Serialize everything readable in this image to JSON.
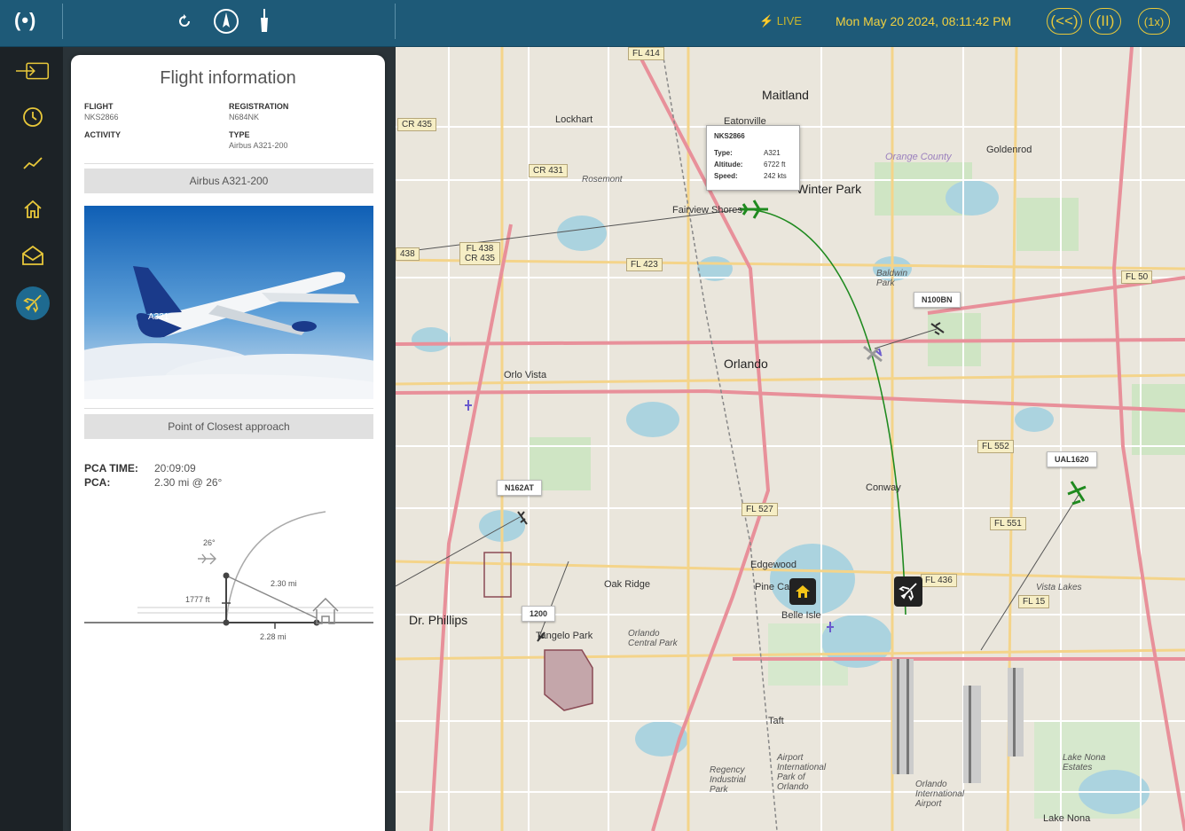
{
  "topbar": {
    "logo": "(•)",
    "live": "⚡ LIVE",
    "datetime": "Mon May 20 2024, 08:11:42 PM",
    "controls": [
      "(<<)",
      "(II)",
      "(1x)"
    ]
  },
  "sidebar": {
    "items": [
      "login-icon",
      "clock-icon",
      "chart-icon",
      "home-icon",
      "mail-icon",
      "plane-icon"
    ]
  },
  "panel": {
    "title": "Flight information",
    "flight_label": "FLIGHT",
    "flight_value": "NKS2866",
    "registration_label": "REGISTRATION",
    "registration_value": "N684NK",
    "activity_label": "ACTIVITY",
    "type_label": "TYPE",
    "type_value": "Airbus A321-200",
    "aircraft_banner": "Airbus A321-200",
    "pca_banner": "Point of Closest approach",
    "pca_time_label": "PCA TIME:",
    "pca_time_value": "20:09:09",
    "pca_label": "PCA:",
    "pca_value": "2.30 mi @ 26°",
    "diagram": {
      "angle": "26°",
      "slant": "2.30 mi",
      "altitude": "1777 ft",
      "ground": "2.28 mi"
    }
  },
  "map": {
    "tooltip": {
      "callsign": "NKS2866",
      "type_label": "Type:",
      "type_value": "A321",
      "altitude_label": "Altitude:",
      "altitude_value": "6722 ft",
      "speed_label": "Speed:",
      "speed_value": "242 kts"
    },
    "aircraft_tags": [
      "N100BN",
      "N162AT",
      "1200",
      "UAL1620"
    ],
    "places": [
      "Maitland",
      "Lockhart",
      "Winter Park",
      "Fairview Shores",
      "Orlando",
      "Orlo Vista",
      "Conway",
      "Edgewood",
      "Pine Castle",
      "Belle Isle",
      "Oak Ridge",
      "Dr. Phillips",
      "Tangelo Park",
      "Goldenrod",
      "Taft",
      "Lake Nona",
      "Orange County",
      "Orlando Central Park",
      "Regency Industrial Park",
      "Airport International Park of Orlando",
      "Orlando International Airport",
      "Lake Nona Estates",
      "Vista Lakes",
      "Baldwin Park",
      "Rosemont",
      "Eatonville"
    ],
    "route_labels": [
      "FL 414",
      "CR 435",
      "CR 431",
      "FL 438 CR 435",
      "FL 423",
      "FL 527",
      "FL 552",
      "FL 551",
      "FL 436",
      "FL 15",
      "FL 50",
      "438"
    ]
  },
  "colors": {
    "topbar": "#1e5a78",
    "accent": "#e8c83a",
    "sidebar": "#1c2226",
    "track": "#2a8a2a"
  }
}
